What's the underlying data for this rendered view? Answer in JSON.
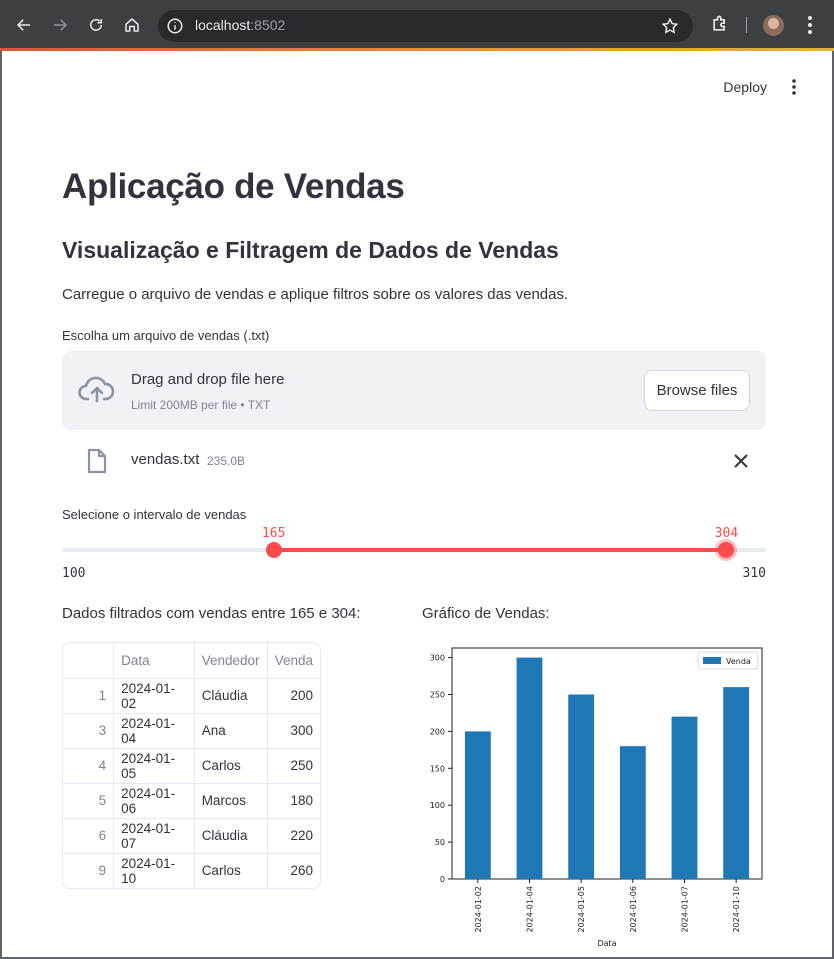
{
  "browser": {
    "url_host": "localhost",
    "url_port": ":8502",
    "accent_color": "#3c4043"
  },
  "header": {
    "deploy_label": "Deploy"
  },
  "main": {
    "title": "Aplicação de Vendas",
    "subtitle": "Visualização e Filtragem de Dados de Vendas",
    "description": "Carregue o arquivo de vendas e aplique filtros sobre os valores das vendas."
  },
  "uploader": {
    "label": "Escolha um arquivo de vendas (.txt)",
    "drop_text": "Drag and drop file here",
    "limit_text": "Limit 200MB per file • TXT",
    "browse_label": "Browse files",
    "file_name": "vendas.txt",
    "file_size": "235.0B"
  },
  "slider": {
    "label": "Selecione o intervalo de vendas",
    "min": 100,
    "max": 310,
    "low": 165,
    "high": 304,
    "accent_color": "#ff4b4b"
  },
  "table": {
    "title": "Dados filtrados com vendas entre 165 e 304:",
    "headers": [
      "",
      "Data",
      "Vendedor",
      "Venda"
    ],
    "rows": [
      {
        "index": "1",
        "data": "2024-01-02",
        "vendedor": "Cláudia",
        "venda": "200"
      },
      {
        "index": "3",
        "data": "2024-01-04",
        "vendedor": "Ana",
        "venda": "300"
      },
      {
        "index": "4",
        "data": "2024-01-05",
        "vendedor": "Carlos",
        "venda": "250"
      },
      {
        "index": "5",
        "data": "2024-01-06",
        "vendedor": "Marcos",
        "venda": "180"
      },
      {
        "index": "6",
        "data": "2024-01-07",
        "vendedor": "Cláudia",
        "venda": "220"
      },
      {
        "index": "9",
        "data": "2024-01-10",
        "vendedor": "Carlos",
        "venda": "260"
      }
    ]
  },
  "chart_section": {
    "title": "Gráfico de Vendas:"
  },
  "chart_data": {
    "type": "bar",
    "categories": [
      "2024-01-02",
      "2024-01-04",
      "2024-01-05",
      "2024-01-06",
      "2024-01-07",
      "2024-01-10"
    ],
    "series": [
      {
        "name": "Venda",
        "values": [
          200,
          300,
          250,
          180,
          220,
          260
        ]
      }
    ],
    "xlabel": "Data",
    "ylabel": "",
    "ylim": [
      0,
      313
    ],
    "yticks": [
      0,
      50,
      100,
      150,
      200,
      250,
      300
    ],
    "legend": "top-right",
    "grid": false,
    "color": "#1f77b4"
  }
}
